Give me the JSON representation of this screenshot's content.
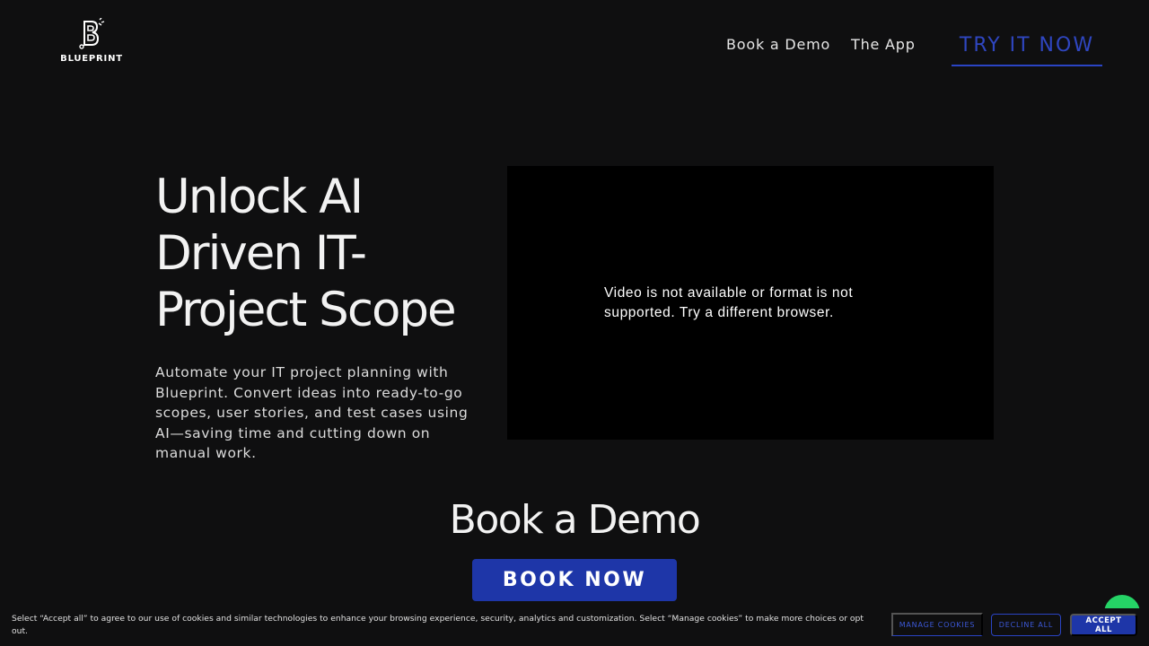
{
  "header": {
    "logo_text": "BLUEPRINT",
    "nav": [
      {
        "label": "Book a Demo"
      },
      {
        "label": "The App"
      }
    ],
    "cta_label": "TRY IT NOW"
  },
  "hero": {
    "title": "Unlock AI Driven IT-Project Scope",
    "description": "Automate your IT project planning with Blueprint. Convert ideas into ready-to-go scopes, user stories, and test cases using AI—saving time and cutting down on manual work.",
    "video_message": "Video is not available or format is not supported. Try a different browser."
  },
  "demo": {
    "heading": "Book a Demo",
    "button_label": "BOOK NOW"
  },
  "cookie_banner": {
    "text": "Select “Accept all” to agree to our use of cookies and similar technologies to enhance your browsing experience, security, analytics and customization. Select “Manage cookies” to make more choices or opt out.",
    "manage_label": "MANAGE COOKIES",
    "decline_label": "DECLINE ALL",
    "accept_label": "ACCEPT ALL"
  },
  "colors": {
    "background": "#0f0f10",
    "accent": "#1e36a8",
    "chat": "#25d366"
  },
  "icons": {
    "logo": "blueprint-b-logo-icon",
    "chat": "chat-bubble-icon"
  }
}
